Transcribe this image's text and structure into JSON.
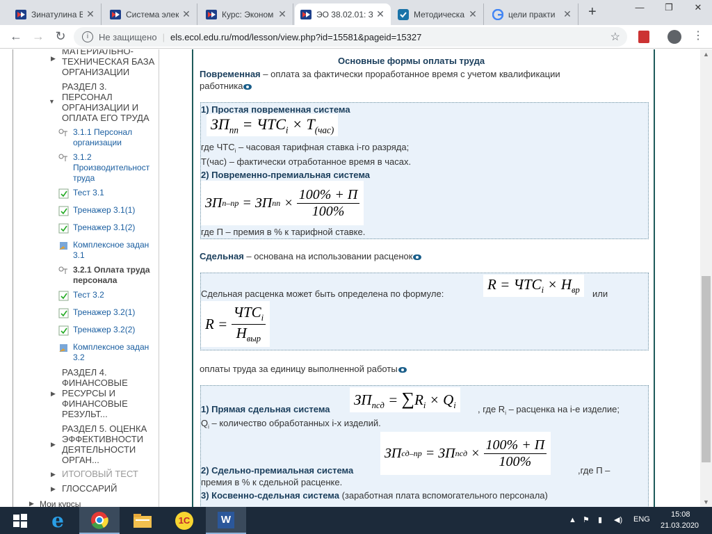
{
  "tabs": [
    {
      "title": "Зинатулина В",
      "icon": "ecol-icon"
    },
    {
      "title": "Система элек",
      "icon": "ecol-icon"
    },
    {
      "title": "Курс: Эконом",
      "icon": "ecol-icon"
    },
    {
      "title": "ЭО 38.02.01: З",
      "icon": "ecol-icon",
      "active": true
    },
    {
      "title": "Методическа",
      "icon": "check-icon"
    },
    {
      "title": "цели практи",
      "icon": "google-icon"
    }
  ],
  "address": {
    "security": "Не защищено",
    "url": "els.ecol.edu.ru/mod/lesson/view.php?id=15581&pageid=15327"
  },
  "sidebar": {
    "sec_material": "МАТЕРИАЛЬНО-ТЕХНИЧЕСКАЯ БАЗА ОРГАНИЗАЦИИ",
    "sec3": "РАЗДЕЛ 3. ПЕРСОНАЛ ОРГАНИЗАЦИИ И ОПЛАТА ЕГО ТРУДА",
    "items": [
      "3.1.1 Персонал организации",
      "3.1.2 Производительност труда",
      "Тест 3.1",
      "Тренажер 3.1(1)",
      "Тренажер 3.1(2)",
      "Комплексное задан 3.1",
      "3.2.1 Оплата труда персонала",
      "Тест 3.2",
      "Тренажер 3.2(1)",
      "Тренажер 3.2(2)",
      "Комплексное задан 3.2"
    ],
    "sec4": "РАЗДЕЛ 4. ФИНАНСОВЫЕ РЕСУРСЫ И ФИНАНСОВЫЕ РЕЗУЛЬТ...",
    "sec5": "РАЗДЕЛ 5. ОЦЕНКА ЭФФЕКТИВНОСТИ ДЕЯТЕЛЬНОСТИ ОРГАН...",
    "final_test": "ИТОГОВЫЙ ТЕСТ",
    "glossary": "ГЛОССАРИЙ",
    "my_courses": "Мои курсы"
  },
  "lesson": {
    "heading": "Основные формы оплаты труда",
    "time_term": "Повременная",
    "time_def": "– оплата за фактически проработанное время с учетом квалификации",
    "time_def2": "работника",
    "simple_title": "1) Простая повременная система",
    "f1": {
      "lhs": "ЗП",
      "lhs_sub": "пп",
      "mid": "ЧТС",
      "mid_sub": "i",
      "rhs": "Т",
      "rhs_sub": "(час)",
      "eq": "=",
      "times": "×"
    },
    "simple_note1": "где ЧТС",
    "simple_note1_sub": "i",
    "simple_note1_rest": "– часовая тарифная ставка i-го разряда;",
    "simple_note2": "Т(час) – фактически отработанное время в часах.",
    "bonus_title": "2) Повременно-премиальная система",
    "f2": {
      "lhs": "ЗП",
      "lhs_sub": "п–пр",
      "mid": "ЗП",
      "mid_sub": "пп",
      "num": "100% + П",
      "den": "100%",
      "eq": "=",
      "times": "×"
    },
    "bonus_note": "где П – премия в % к тарифной ставке.",
    "piece_term": "Сдельная",
    "piece_def": "– основана на использовании расценок",
    "rate_text": "Сдельная расценка может быть определена по формуле:",
    "f3": {
      "lhs": "R",
      "eq": "=",
      "mid": "ЧТС",
      "mid_sub": "i",
      "times": "×",
      "rhs": "Н",
      "rhs_sub": "вр"
    },
    "or": "или",
    "f4": {
      "lhs": "R",
      "eq": "=",
      "num": "ЧТС",
      "num_sub": "i",
      "den": "Н",
      "den_sub": "выр"
    },
    "unit_text": "оплаты труда за единицу выполненной работы",
    "direct_title": "1) Прямая сдельная система",
    "f5": {
      "lhs": "ЗП",
      "lhs_sub": "псд",
      "eq": "=",
      "sum": "∑",
      "r": "R",
      "r_sub": "i",
      "times": "×",
      "q": "Q",
      "q_sub": "i"
    },
    "direct_note1": ", где R",
    "direct_note1_sub": "i",
    "direct_note1_rest": "– расценка на i-е изделие;",
    "direct_note2_q": "Q",
    "direct_note2_sub": "i",
    "direct_note2": "– количество обработанных i-х изделий.",
    "piecebonus_title": "2) Сдельно-премиальная система",
    "f6": {
      "lhs": "ЗП",
      "lhs_sub": "сд–пр",
      "mid": "ЗП",
      "mid_sub": "псд",
      "num": "100% + П",
      "den": "100%",
      "eq": "=",
      "times": "×"
    },
    "piecebonus_note": ",где П –",
    "piecebonus_note2": "премия в % к сдельной расценке.",
    "indirect_title": "3) Косвенно-сдельная система",
    "indirect_note": "(заработная плата вспомогательного персонала)"
  },
  "tray": {
    "lang": "ENG",
    "time": "15:08",
    "date": "21.03.2020"
  }
}
